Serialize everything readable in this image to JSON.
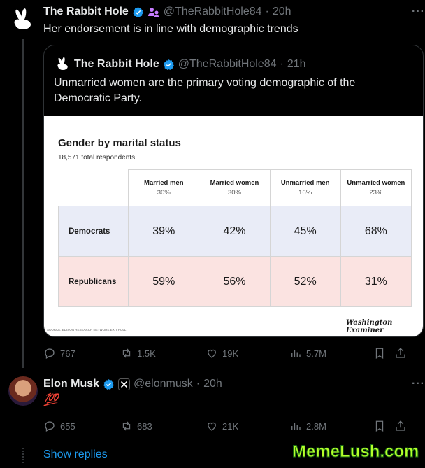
{
  "post1": {
    "author": "The Rabbit Hole",
    "handle": "@TheRabbitHole84",
    "time": "20h",
    "text": "Her endorsement is in line with demographic trends",
    "quote": {
      "author": "The Rabbit Hole",
      "handle": "@TheRabbitHole84",
      "time": "21h",
      "text": "Unmarried women are the primary voting demographic of the Democratic Party."
    },
    "stats": {
      "replies": "767",
      "reposts": "1.5K",
      "likes": "19K",
      "views": "5.7M"
    }
  },
  "chart_data": {
    "type": "table",
    "title": "Gender by marital status",
    "subtitle": "18,571 total respondents",
    "columns": [
      {
        "label": "Married men",
        "share": "30%"
      },
      {
        "label": "Married women",
        "share": "30%"
      },
      {
        "label": "Unmarried men",
        "share": "16%"
      },
      {
        "label": "Unmarried women",
        "share": "23%"
      }
    ],
    "rows": [
      {
        "label": "Democrats",
        "values": [
          "39%",
          "42%",
          "45%",
          "68%"
        ],
        "color": "#e9ecf7"
      },
      {
        "label": "Republicans",
        "values": [
          "59%",
          "56%",
          "52%",
          "31%"
        ],
        "color": "#fbe3e1"
      }
    ],
    "source": "SOURCE: EDISON RESEARCH NETWORK EXIT POLL",
    "brand": "Washington Examiner"
  },
  "post2": {
    "author": "Elon Musk",
    "handle": "@elonmusk",
    "time": "20h",
    "text": "💯",
    "stats": {
      "replies": "655",
      "reposts": "683",
      "likes": "21K",
      "views": "2.8M"
    }
  },
  "show_replies": "Show replies",
  "watermark": "MemeLush.com",
  "colors": {
    "accent": "#1d9bf0",
    "verified": "#1d9bf0",
    "background": "#000000",
    "muted": "#71767b"
  }
}
